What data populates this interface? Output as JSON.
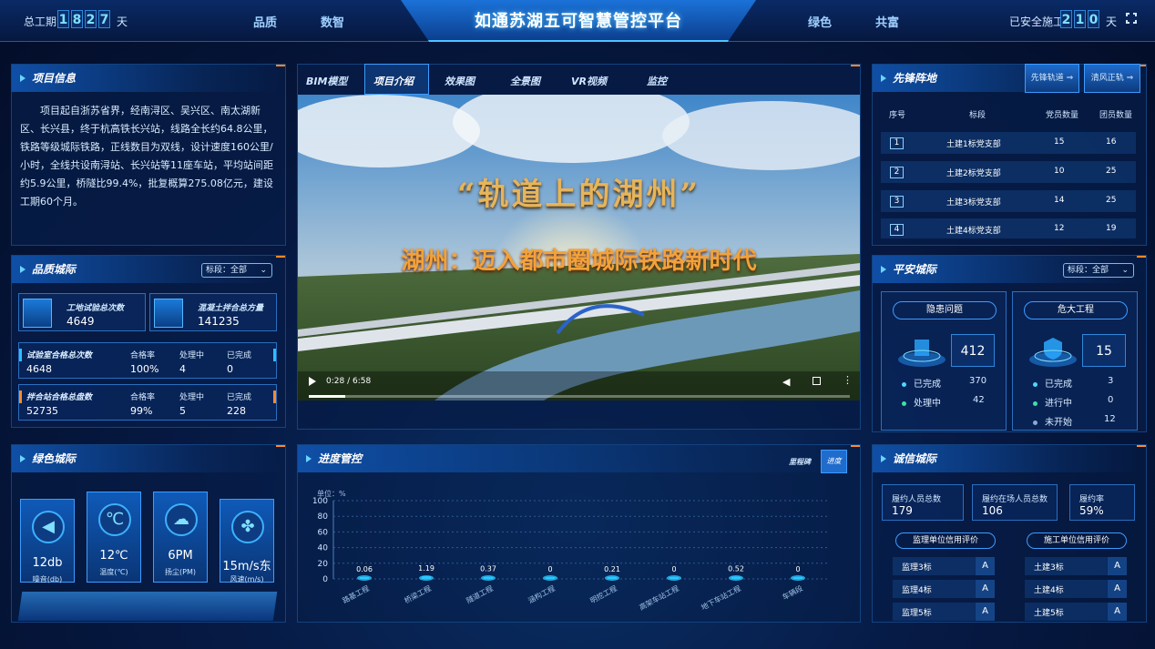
{
  "header": {
    "title": "如通苏湖五可智慧管控平台",
    "total_label": "总工期",
    "total_digits": [
      "1",
      "8",
      "2",
      "7"
    ],
    "total_unit": "天",
    "safe_label": "已安全施工",
    "safe_digits": [
      "2",
      "1",
      "0"
    ],
    "safe_unit": "天",
    "nav_left": [
      "品质",
      "数智"
    ],
    "nav_right": [
      "绿色",
      "共富"
    ],
    "fullscreen_icon": "expand-icon"
  },
  "project_info": {
    "title": "项目信息",
    "text": "项目起自浙苏省界，经南浔区、吴兴区、南太湖新区、长兴县，终于杭高铁长兴站，线路全长约64.8公里，铁路等级城际铁路，正线数目为双线，设计速度160公里/小时，全线共设南浔站、长兴站等11座车站，平均站间距约5.9公里，桥隧比99.4%，批复概算275.08亿元，建设工期60个月。"
  },
  "quality": {
    "title": "品质城际",
    "filter": "标段：全部",
    "box1_label": "工地试验总次数",
    "box1_value": "4649",
    "box2_label": "混凝土拌合总方量",
    "box2_value": "141235",
    "rows": [
      {
        "label": "试验室合格总次数",
        "value": "4648",
        "rate_label": "合格率",
        "rate": "100%",
        "proc_label": "处理中",
        "proc": "4",
        "done_label": "已完成",
        "done": "0"
      },
      {
        "label": "拌合站合格总盘数",
        "value": "52735",
        "rate_label": "合格率",
        "rate": "99%",
        "proc_label": "处理中",
        "proc": "5",
        "done_label": "已完成",
        "done": "228"
      }
    ]
  },
  "center": {
    "tabs": [
      "BIM模型",
      "项目介绍",
      "效果图",
      "全景图",
      "VR视频",
      "监控"
    ],
    "active_tab": "项目介绍",
    "video": {
      "headline": "“轨道上的湖州”",
      "subline": "湖州：迈入都市圈城际铁路新时代",
      "time": "0:28 / 6:58",
      "progress": 0.067
    }
  },
  "vanguard": {
    "title": "先锋阵地",
    "btn1": "先锋轨道 ⇒",
    "btn2": "清风正轨 ⇒",
    "headers": [
      "序号",
      "标段",
      "党员数量",
      "团员数量"
    ],
    "rows": [
      {
        "no": "1",
        "name": "土建1标党支部",
        "party": "15",
        "league": "16"
      },
      {
        "no": "2",
        "name": "土建2标党支部",
        "party": "10",
        "league": "25"
      },
      {
        "no": "3",
        "name": "土建3标党支部",
        "party": "14",
        "league": "25"
      },
      {
        "no": "4",
        "name": "土建4标党支部",
        "party": "12",
        "league": "19"
      }
    ]
  },
  "safety": {
    "title": "平安城际",
    "filter": "标段：全部",
    "hidden": {
      "title": "隐患问题",
      "total": "412",
      "items": [
        {
          "label": "已完成",
          "value": "370",
          "color": "#4fd6ff"
        },
        {
          "label": "处理中",
          "value": "42",
          "color": "#3ee0a8"
        }
      ]
    },
    "major": {
      "title": "危大工程",
      "total": "15",
      "items": [
        {
          "label": "已完成",
          "value": "3",
          "color": "#4fd6ff"
        },
        {
          "label": "进行中",
          "value": "0",
          "color": "#3ee0a8"
        },
        {
          "label": "未开始",
          "value": "12",
          "color": "#8aa9d6"
        }
      ]
    }
  },
  "green": {
    "title": "绿色城际",
    "cards": [
      {
        "icon": "speaker-icon",
        "value": "12db",
        "label": "噪音(db)"
      },
      {
        "icon": "thermometer-icon",
        "value": "12℃",
        "label": "温度(℃)"
      },
      {
        "icon": "cloud-icon",
        "value": "6PM",
        "label": "扬尘(PM)"
      },
      {
        "icon": "fan-icon",
        "value": "15m/s东",
        "label": "风速(m/s)"
      }
    ]
  },
  "progress": {
    "title": "进度管控",
    "btn1": "里程碑",
    "btn2": "进度",
    "unit": "单位：%"
  },
  "chart_data": {
    "type": "bar",
    "categories": [
      "路基工程",
      "桥梁工程",
      "隧道工程",
      "涵构工程",
      "明挖工程",
      "高架车站工程",
      "地下车站工程",
      "车辆段"
    ],
    "values": [
      0.06,
      1.19,
      0.37,
      0,
      0.21,
      0,
      0.52,
      0
    ],
    "ylim": [
      0,
      100
    ],
    "yticks": [
      0,
      20,
      40,
      60,
      80,
      100
    ],
    "ylabel": "单位：%"
  },
  "credit": {
    "title": "诚信城际",
    "boxes": [
      {
        "label": "履约人员总数",
        "value": "179"
      },
      {
        "label": "履约在场人员总数",
        "value": "106"
      },
      {
        "label": "履约率",
        "value": "59%"
      }
    ],
    "supervision": {
      "title": "监理单位信用评价",
      "rows": [
        {
          "name": "监理3标",
          "grade": "A"
        },
        {
          "name": "监理4标",
          "grade": "A"
        },
        {
          "name": "监理5标",
          "grade": "A"
        }
      ]
    },
    "construction": {
      "title": "施工单位信用评价",
      "rows": [
        {
          "name": "土建3标",
          "grade": "A"
        },
        {
          "name": "土建4标",
          "grade": "A"
        },
        {
          "name": "土建5标",
          "grade": "A"
        }
      ]
    }
  }
}
